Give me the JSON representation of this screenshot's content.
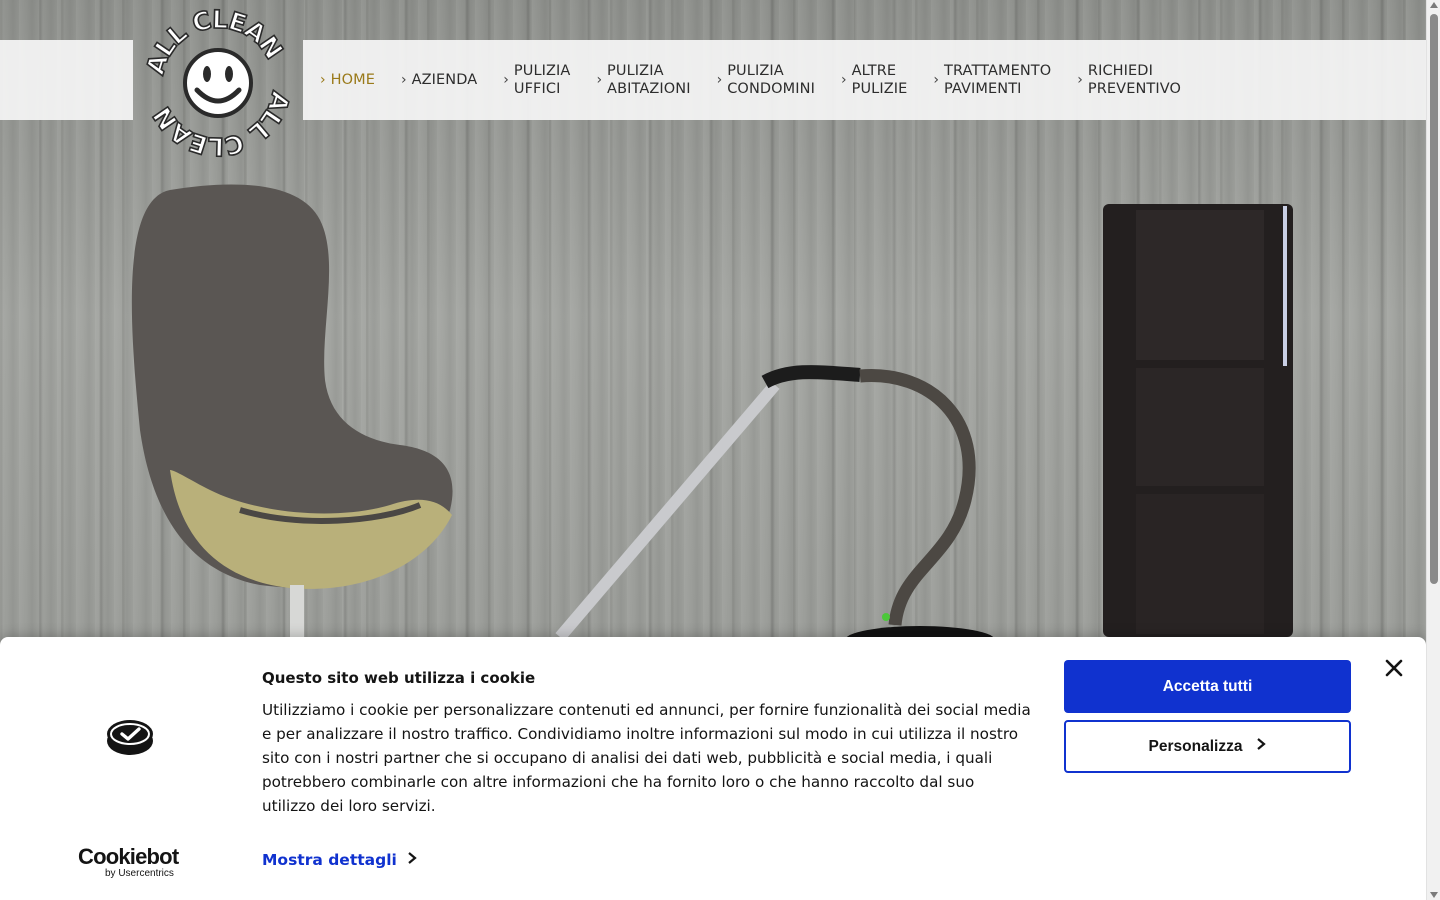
{
  "logo": {
    "text_top": "ALL CLEAN",
    "text_bottom": "ALL CLEAN"
  },
  "nav": {
    "items": [
      {
        "label": "HOME",
        "active": true
      },
      {
        "label": "AZIENDA"
      },
      {
        "label": "PULIZIA\nUFFICI"
      },
      {
        "label": "PULIZIA\nABITAZIONI"
      },
      {
        "label": "PULIZIA\nCONDOMINI"
      },
      {
        "label": "ALTRE\nPULIZIE"
      },
      {
        "label": "TRATTAMENTO\nPAVIMENTI"
      },
      {
        "label": "RICHIEDI\nPREVENTIVO"
      }
    ],
    "chevron": "›"
  },
  "cookie_banner": {
    "title": "Questo sito web utilizza i cookie",
    "body": "Utilizziamo i cookie per personalizzare contenuti ed annunci, per fornire funzionalità dei social media e per analizzare il nostro traffico. Condividiamo inoltre informazioni sul modo in cui utilizza il nostro sito con i nostri partner che si occupano di analisi dei dati web, pubblicità e social media, i quali potrebbero combinarle con altre informazioni che ha fornito loro o che hanno raccolto dal suo utilizzo dei loro servizi.",
    "details_label": "Mostra dettagli",
    "accept_label": "Accetta tutti",
    "customize_label": "Personalizza",
    "brand_name": "Cookiebot",
    "brand_sub": "by Usercentrics",
    "accent_color": "#1032cf"
  },
  "colors": {
    "active_nav": "#9a7a1a",
    "header_bg": "#f5f5f5"
  }
}
